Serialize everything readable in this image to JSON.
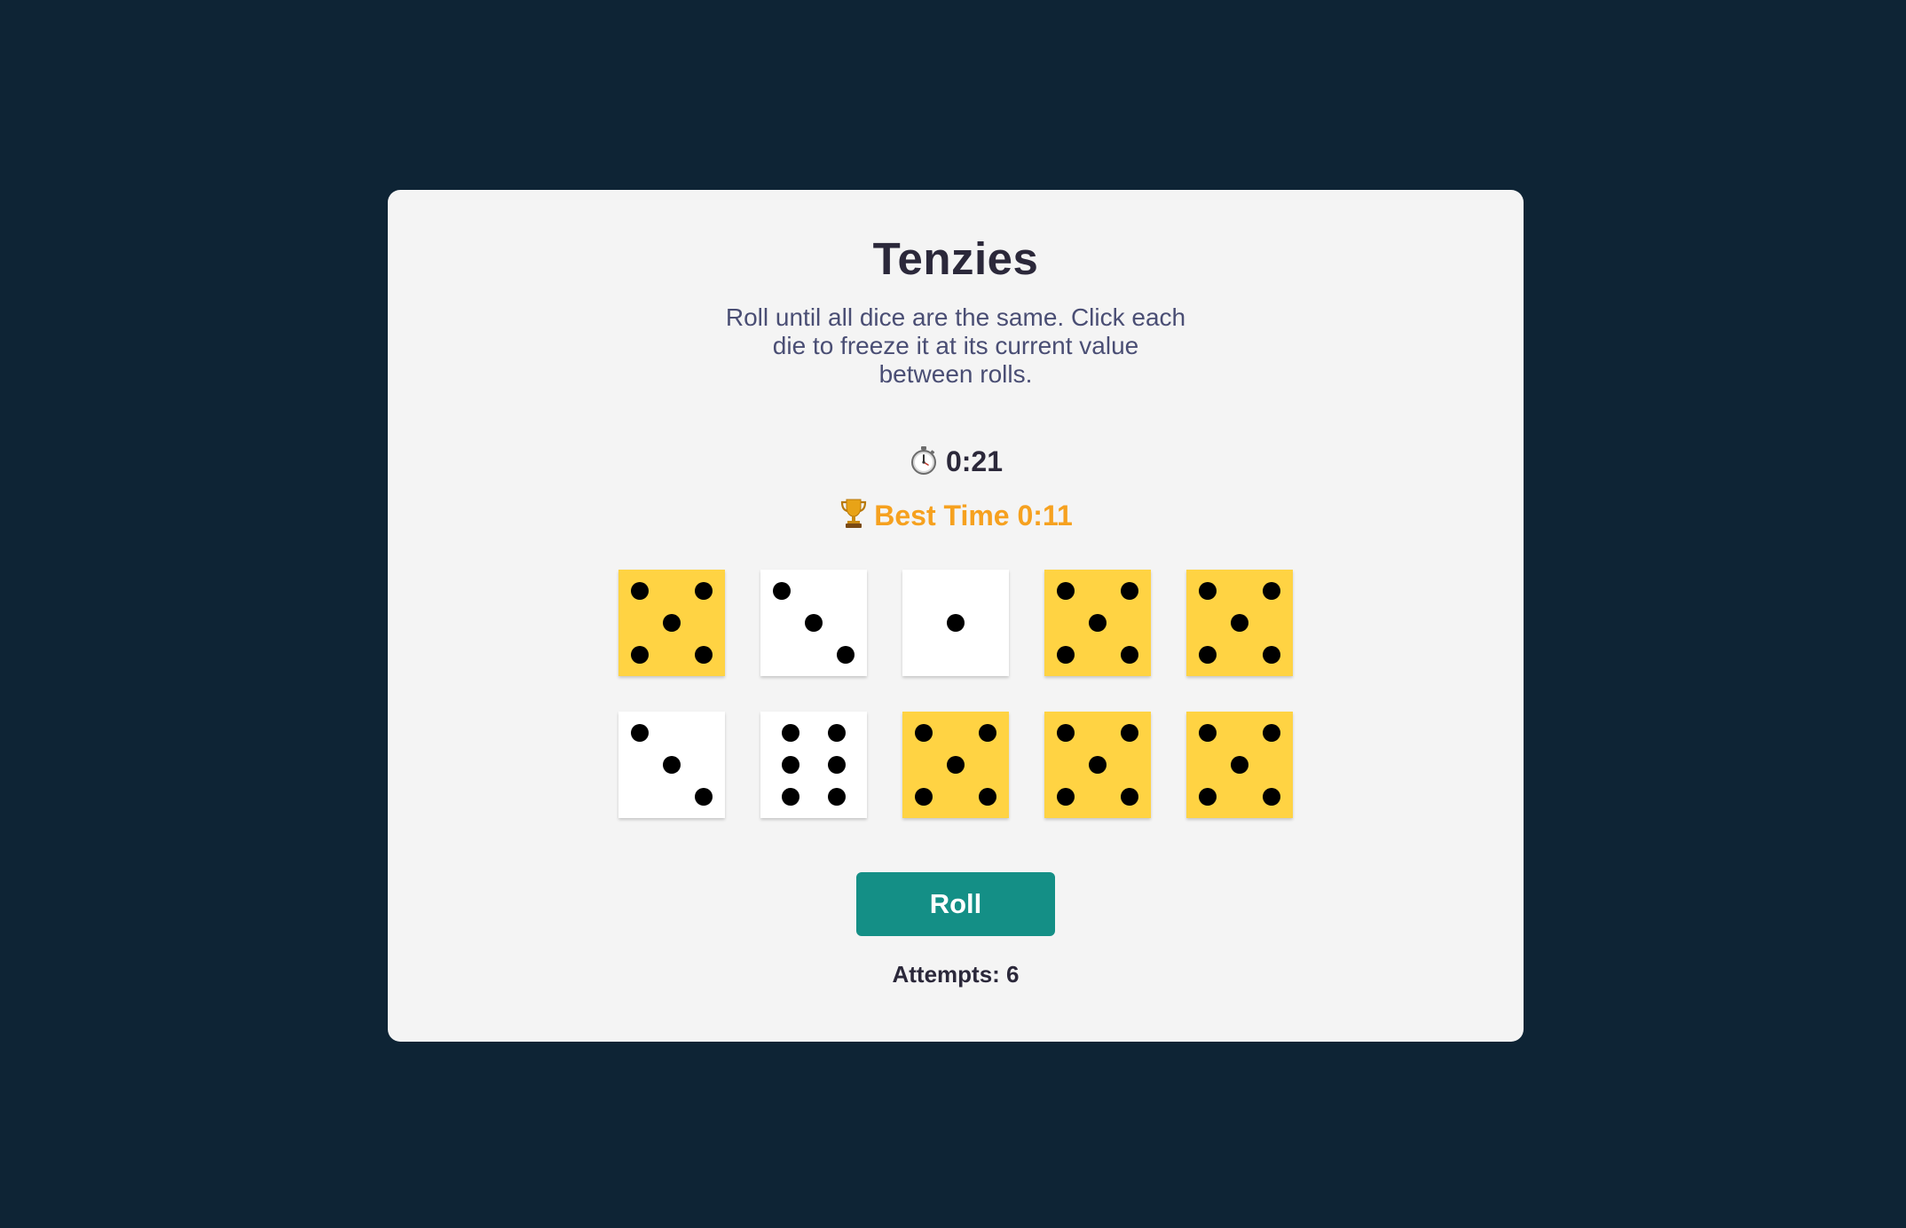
{
  "title": "Tenzies",
  "instructions": "Roll until all dice are the same. Click each die to freeze it at its current value between rolls.",
  "timer": {
    "icon": "stopwatch-icon",
    "value": "0:21"
  },
  "best_time": {
    "icon": "trophy-icon",
    "label": "Best Time 0:11"
  },
  "dice": [
    {
      "value": 5,
      "held": true
    },
    {
      "value": 3,
      "held": false
    },
    {
      "value": 1,
      "held": false
    },
    {
      "value": 5,
      "held": true
    },
    {
      "value": 5,
      "held": true
    },
    {
      "value": 3,
      "held": false
    },
    {
      "value": 6,
      "held": false
    },
    {
      "value": 5,
      "held": true
    },
    {
      "value": 5,
      "held": true
    },
    {
      "value": 5,
      "held": true
    }
  ],
  "roll_button": {
    "label": "Roll"
  },
  "attempts": "Attempts: 6",
  "colors": {
    "background": "#0e2435",
    "panel": "#f4f4f4",
    "held_die": "#ffd343",
    "free_die": "#ffffff",
    "button": "#148f86",
    "best_time_text": "#f6a11f"
  }
}
